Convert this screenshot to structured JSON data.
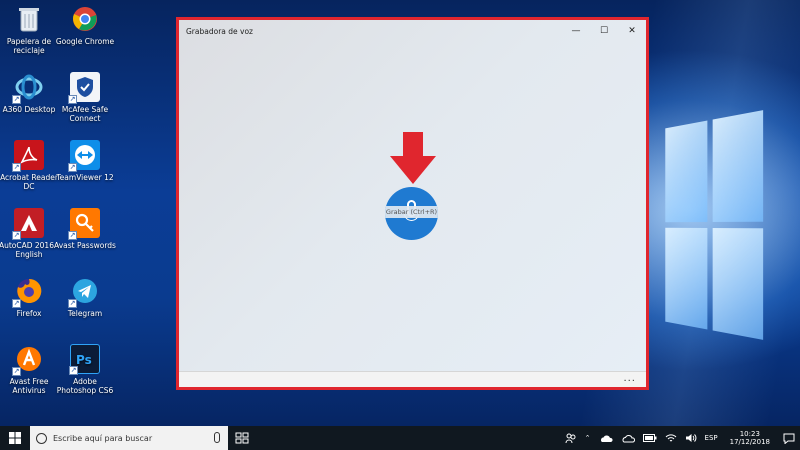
{
  "desktop_icons": [
    {
      "label": "Papelera de reciclaje",
      "icon": "recycle-bin-icon"
    },
    {
      "label": "Google Chrome",
      "icon": "chrome-icon"
    },
    {
      "label": "A360 Desktop",
      "icon": "a360-icon"
    },
    {
      "label": "McAfee Safe Connect",
      "icon": "mcafee-icon"
    },
    {
      "label": "Acrobat Reader DC",
      "icon": "acrobat-icon"
    },
    {
      "label": "TeamViewer 12",
      "icon": "teamviewer-icon"
    },
    {
      "label": "AutoCAD 2016 - English",
      "icon": "autocad-icon"
    },
    {
      "label": "Avast Passwords",
      "icon": "avast-passwords-icon"
    },
    {
      "label": "Firefox",
      "icon": "firefox-icon"
    },
    {
      "label": "Telegram",
      "icon": "telegram-icon"
    },
    {
      "label": "Avast Free Antivirus",
      "icon": "avast-icon"
    },
    {
      "label": "Adobe Photoshop CS6",
      "icon": "photoshop-icon"
    }
  ],
  "window": {
    "title": "Grabadora de voz",
    "record_tooltip": "Grabar (Ctrl+R)",
    "more_label": "...",
    "minimize": "—",
    "maximize": "☐",
    "close": "✕"
  },
  "taskbar": {
    "search_placeholder": "Escribe aquí para buscar",
    "language": "ESP",
    "time": "10:23",
    "date": "17/12/2018"
  },
  "colors": {
    "accent": "#1f7ad1",
    "highlight_border": "#e0262e",
    "arrow": "#e0262e"
  }
}
